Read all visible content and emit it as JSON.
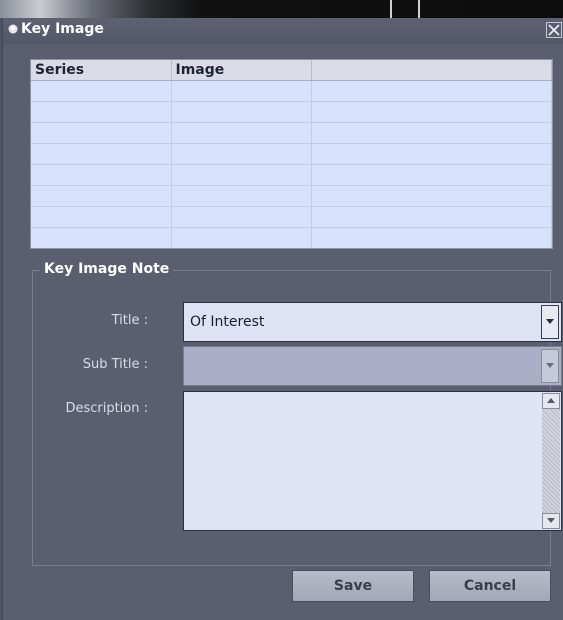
{
  "window": {
    "title": "Key Image"
  },
  "grid": {
    "columns": [
      "Series",
      "Image",
      ""
    ],
    "rows": [
      [
        "",
        "",
        ""
      ],
      [
        "",
        "",
        ""
      ],
      [
        "",
        "",
        ""
      ],
      [
        "",
        "",
        ""
      ],
      [
        "",
        "",
        ""
      ],
      [
        "",
        "",
        ""
      ],
      [
        "",
        "",
        ""
      ],
      [
        "",
        "",
        ""
      ]
    ]
  },
  "note": {
    "legend": "Key Image Note",
    "title_label": "Title :",
    "title_value": "Of Interest",
    "subtitle_label": "Sub Title :",
    "subtitle_value": "",
    "description_label": "Description :",
    "description_value": ""
  },
  "buttons": {
    "save_label": "Save",
    "cancel_label": "Cancel"
  },
  "icons": {
    "window": "circle-bullet-icon",
    "close": "close-icon",
    "dropdown": "chevron-down-icon",
    "scroll_up": "scroll-up-icon",
    "scroll_down": "scroll-down-icon"
  },
  "colors": {
    "dialog_background": "#5b5e6e",
    "grid_background": "#d6e2fb",
    "field_background": "#dee2f4",
    "button_background": "#b1b4c3"
  }
}
